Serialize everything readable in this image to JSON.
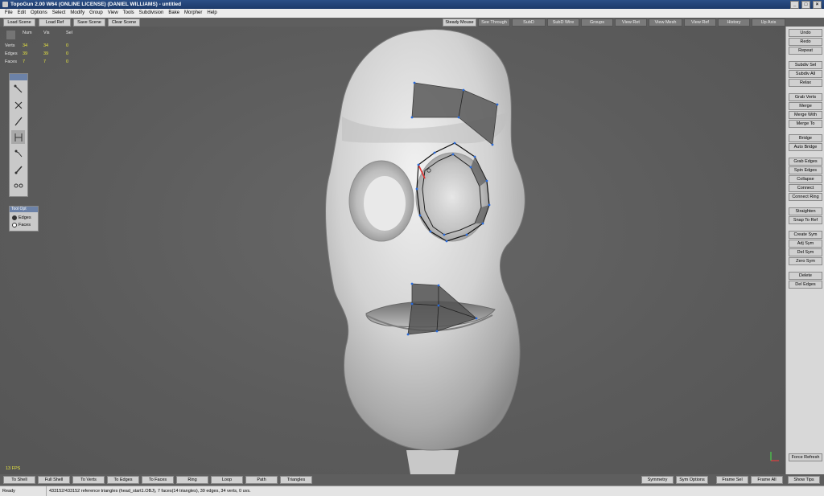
{
  "window": {
    "title": "TopoGun 2.00 W64  (ONLINE LICENSE) (DANIEL WILLIAMS) - untitled",
    "controls": [
      "_",
      "□",
      "×"
    ]
  },
  "menu": [
    "File",
    "Edit",
    "Options",
    "Select",
    "Modify",
    "Group",
    "View",
    "Tools",
    "Subdivision",
    "Bake",
    "Morpher",
    "Help"
  ],
  "top_left_buttons": [
    "Load Scene",
    "Load Ref",
    "Save Scene",
    "Clear Scene"
  ],
  "top_right_buttons": [
    "Steady Mouse",
    "See Through",
    "SubD",
    "SubD Wire",
    "Groups",
    "View Ret",
    "View Mesh",
    "View Ref",
    "History",
    "Up Axis"
  ],
  "stats": {
    "headers": [
      "Num",
      "Vis",
      "Sel"
    ],
    "rows": [
      {
        "label": "Verts",
        "num": "34",
        "vis": "34",
        "sel": "0"
      },
      {
        "label": "Edges",
        "num": "39",
        "vis": "39",
        "sel": "0"
      },
      {
        "label": "Faces",
        "num": "7",
        "vis": "7",
        "sel": "0"
      }
    ]
  },
  "tool_options": {
    "header": "Tool Opt",
    "options": [
      "Edges",
      "Faces"
    ],
    "selected": "Edges"
  },
  "right_buttons": [
    [
      "Undo",
      "Redo",
      "Repeat"
    ],
    [
      "Subdiv Sel",
      "Subdiv All",
      "Relax"
    ],
    [
      "Grab Verts",
      "Merge",
      "Merge With",
      "Merge To"
    ],
    [
      "Bridge",
      "Auto Bridge"
    ],
    [
      "Grab Edges",
      "Spin Edges",
      "Collapse",
      "Connect",
      "Connect Ring"
    ],
    [
      "Straighten",
      "Snap To Ref"
    ],
    [
      "Create Sym",
      "Adj Sym",
      "Del Sym",
      "Zero Sym"
    ],
    [
      "Delete",
      "Del Edges"
    ]
  ],
  "force_refresh": "Force Refresh",
  "fps": "13 FPS",
  "bottom_left_buttons": [
    "To Shell",
    "Full Shell",
    "To Verts",
    "To Edges",
    "To Faces",
    "Ring",
    "Loop",
    "Path",
    "Triangles"
  ],
  "bottom_right_buttons": [
    "Symmetry",
    "Sym Options",
    "Frame Sel",
    "Frame All",
    "Show Tips"
  ],
  "status": {
    "state": "Ready",
    "info": "433152/433152 reference triangles (head_start1.OBJ), 7 faces(14 triangles), 39 edges, 34 verts, 0 uvs."
  },
  "colors": {
    "titlebar": "#1d3a6a",
    "viewport": "#5b5b5b",
    "selected_edge": "#e03030",
    "vertex": "#2a6ad8",
    "stat_values": "#e8e640"
  }
}
